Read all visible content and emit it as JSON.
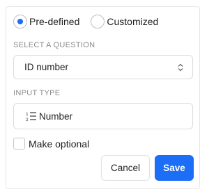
{
  "question_source": {
    "options": [
      {
        "label": "Pre-defined",
        "selected": true
      },
      {
        "label": "Customized",
        "selected": false
      }
    ]
  },
  "select_question": {
    "label": "SELECT A QUESTION",
    "value": "ID number",
    "icon": "sort-arrows-icon"
  },
  "input_type": {
    "label": "INPUT TYPE",
    "value": "Number",
    "icon": "numbered-list-icon"
  },
  "optional": {
    "label": "Make optional",
    "checked": false
  },
  "actions": {
    "cancel_label": "Cancel",
    "save_label": "Save"
  },
  "colors": {
    "accent": "#1b6ef5",
    "border": "#dcdcdc",
    "muted_text": "#8a8a8a"
  }
}
